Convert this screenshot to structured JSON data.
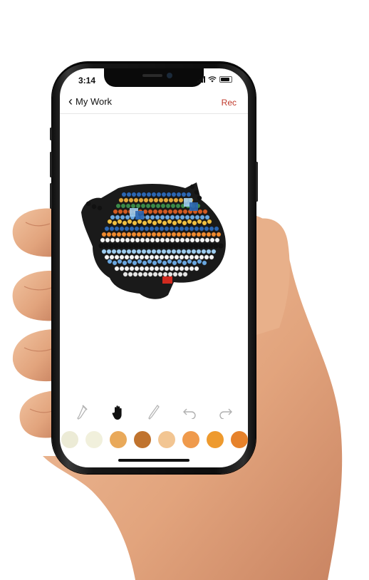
{
  "status_bar": {
    "time": "3:14"
  },
  "nav": {
    "back_label": "My Work",
    "action_label": "Rec"
  },
  "toolbar": {
    "tools": [
      {
        "name": "eyedropper",
        "icon": "eyedropper-icon"
      },
      {
        "name": "pan",
        "icon": "hand-icon",
        "active": true
      },
      {
        "name": "paint",
        "icon": "pencil-icon"
      },
      {
        "name": "undo",
        "icon": "undo-icon"
      },
      {
        "name": "redo",
        "icon": "redo-icon"
      }
    ]
  },
  "palette": {
    "colors": [
      "#ecebd6",
      "#f1f0dc",
      "#e9a95a",
      "#c0732e",
      "#f2c592",
      "#ef9a4c",
      "#ee9a2e",
      "#e6822b"
    ]
  },
  "colors": {
    "accent": "#c0392b",
    "skin": "#e8b08a"
  }
}
